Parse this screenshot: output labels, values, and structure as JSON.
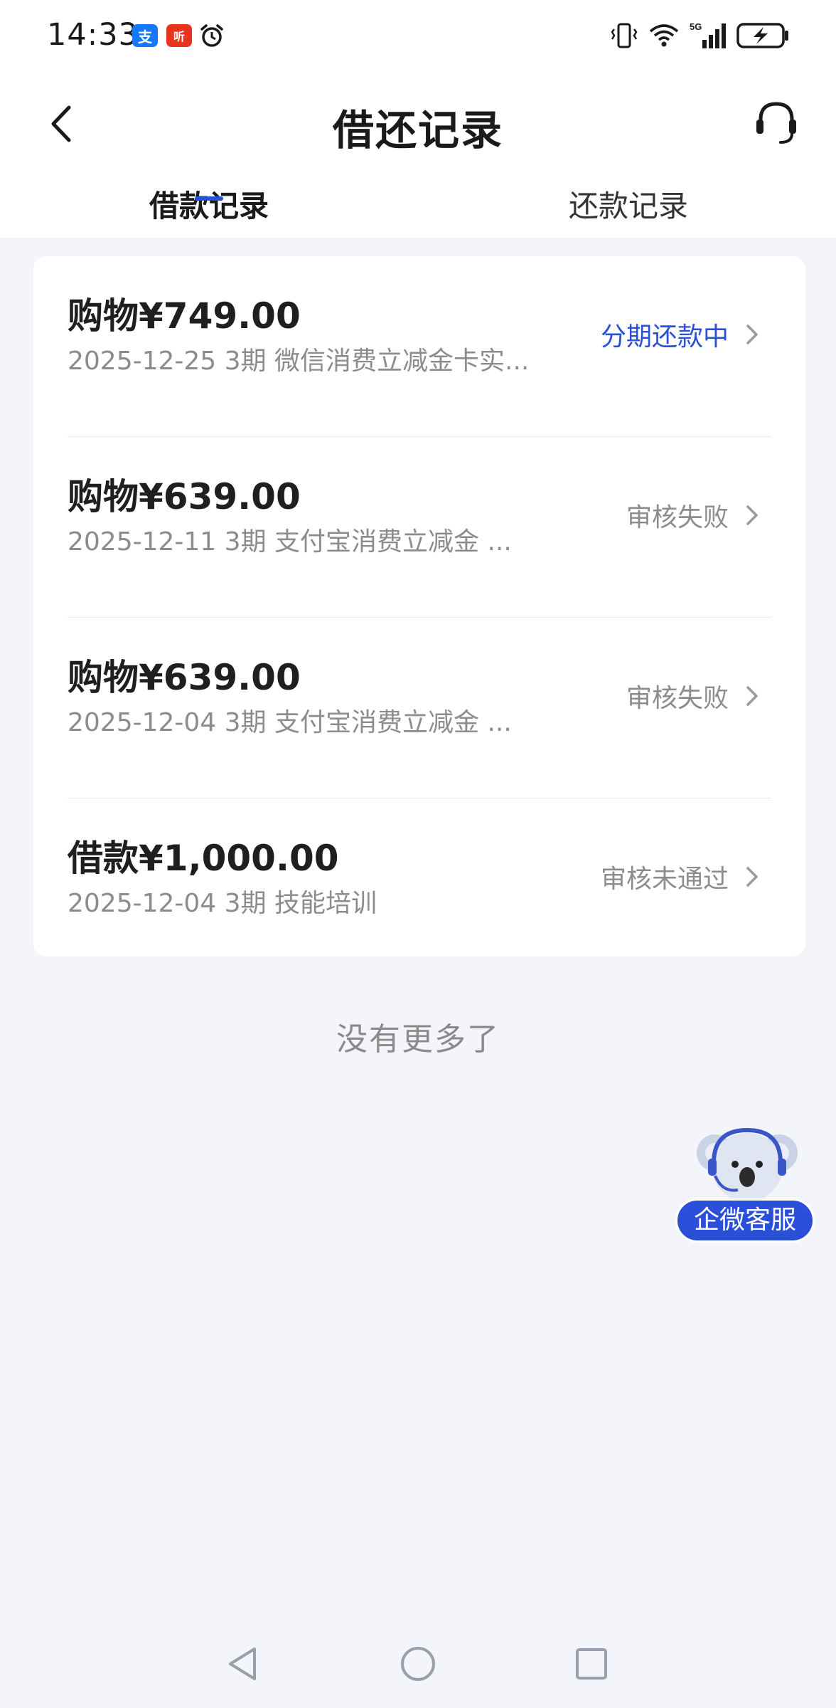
{
  "status_bar": {
    "time": "14:33",
    "app_icons": [
      {
        "name": "alipay-icon",
        "glyph": "支",
        "color": "#1677ff"
      },
      {
        "name": "listen-app-icon",
        "glyph": "听",
        "color": "#e8341c"
      }
    ],
    "network": "5G"
  },
  "header": {
    "title": "借还记录",
    "back_icon": "chevron-left-icon",
    "service_icon": "headset-icon"
  },
  "tabs": [
    {
      "label": "借款记录",
      "active": true
    },
    {
      "label": "还款记录",
      "active": false
    }
  ],
  "records": [
    {
      "title": "购物¥749.00",
      "subtitle": "2025-12-25 3期  微信消费立减金卡实...",
      "status": "分期还款中",
      "status_active": true
    },
    {
      "title": "购物¥639.00",
      "subtitle": "2025-12-11 3期  支付宝消费立减金 ...",
      "status": "审核失败",
      "status_active": false
    },
    {
      "title": "购物¥639.00",
      "subtitle": "2025-12-04 3期  支付宝消费立减金 ...",
      "status": "审核失败",
      "status_active": false
    },
    {
      "title": "借款¥1,000.00",
      "subtitle": "2025-12-04 3期  技能培训",
      "status": "审核未通过",
      "status_active": false
    }
  ],
  "no_more_text": "没有更多了",
  "floating_service": {
    "label": "企微客服"
  },
  "colors": {
    "accent": "#2a4fd8",
    "background": "#f4f5fa",
    "card": "#ffffff",
    "muted_text": "#8c8c8c"
  }
}
